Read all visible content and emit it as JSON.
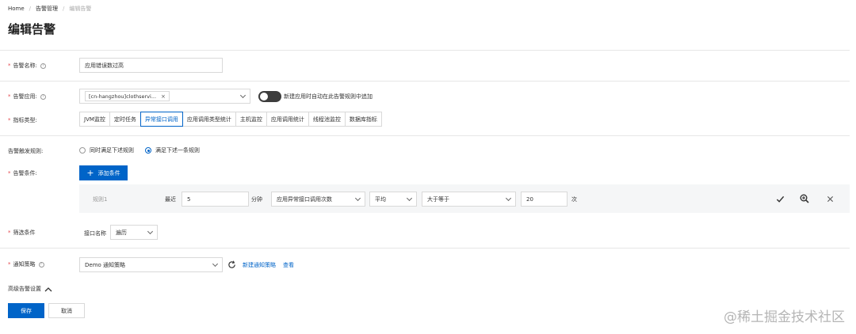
{
  "breadcrumb": {
    "home": "Home",
    "parent": "告警管理",
    "current": "编辑告警"
  },
  "page_title": "编辑告警",
  "form": {
    "alert_name": {
      "label": "告警名称:",
      "value": "应用错误数过高"
    },
    "alert_app": {
      "label": "告警应用:",
      "tag": "[cn-hangzhou]clothservi...",
      "toggle_label": "新建应用时自动在此告警规则中追加"
    },
    "metric_type": {
      "label": "指标类型:",
      "tabs": [
        "JVM监控",
        "定时任务",
        "异常接口调用",
        "应用调用类型统计",
        "主机监控",
        "应用调用统计",
        "线程池监控",
        "数据库指标"
      ],
      "active_index": 2
    },
    "trigger_rule": {
      "label": "告警触发规则:",
      "options": [
        "同时满足下述规则",
        "满足下述一条规则"
      ],
      "selected_index": 1
    },
    "condition": {
      "label": "告警条件:",
      "add_button": "添加条件",
      "rule": {
        "name": "规则1",
        "recent_label": "最近",
        "minutes": "5",
        "minutes_unit": "分钟",
        "metric": "应用异常接口调用次数",
        "aggregation": "平均",
        "operator": "大于等于",
        "threshold": "20",
        "threshold_unit": "次"
      }
    },
    "filter": {
      "label": "筛选条件",
      "field_label": "接口名称",
      "field_value": "遍历"
    },
    "notify": {
      "label": "通知策略",
      "value": "Demo 通知策略",
      "new_link": "新建通知策略",
      "view_link": "查看"
    },
    "advanced_label": "高级告警设置",
    "save_button": "保存",
    "cancel_button": "取消"
  },
  "watermark": "@稀土掘金技术社区",
  "colors": {
    "primary": "#0064c8",
    "required": "#e5484d",
    "toggle_off": "#3d3d3d"
  }
}
